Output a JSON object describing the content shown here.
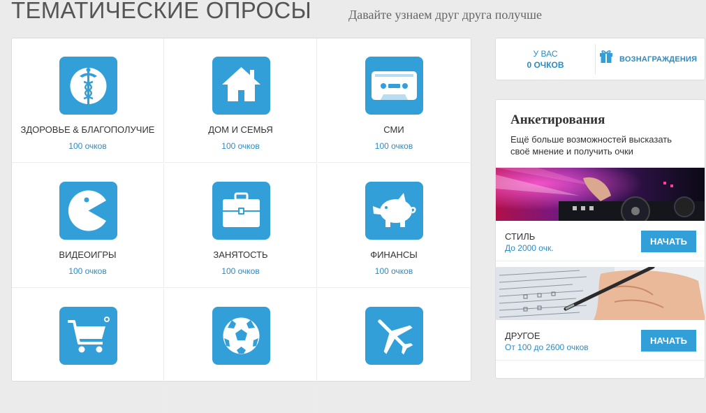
{
  "header": {
    "title": "ТЕМАТИЧЕСКИЕ ОПРОСЫ",
    "subtitle": "Давайте узнаем друг друга получше"
  },
  "categories": [
    {
      "label": "Здоровье & Благополучие",
      "points": "100 очков",
      "icon": "caduceus-icon"
    },
    {
      "label": "Дом и семья",
      "points": "100 очков",
      "icon": "house-icon"
    },
    {
      "label": "СМИ",
      "points": "100 очков",
      "icon": "cassette-icon"
    },
    {
      "label": "Видеоигры",
      "points": "100 очков",
      "icon": "pacman-icon"
    },
    {
      "label": "Занятость",
      "points": "100 очков",
      "icon": "briefcase-icon"
    },
    {
      "label": "Финансы",
      "points": "100 очков",
      "icon": "piggy-bank-icon"
    },
    {
      "label": "",
      "points": "",
      "icon": "shopping-cart-icon"
    },
    {
      "label": "",
      "points": "",
      "icon": "soccer-ball-icon"
    },
    {
      "label": "",
      "points": "",
      "icon": "airplane-icon"
    }
  ],
  "points_box": {
    "you_have": "У ВАС",
    "value": "0 ОЧКОВ",
    "rewards_label": "ВОЗНАГРАЖДЕНИЯ"
  },
  "surveys": {
    "title": "Анкетирования",
    "description": "Ещё больше возможностей высказать своё мнение и получить очки",
    "items": [
      {
        "name": "СТИЛЬ",
        "reward": "До 2000 очк.",
        "button": "НАЧАТЬ",
        "image": "dj-mixer-image"
      },
      {
        "name": "ДРУГОЕ",
        "reward": "От 100 до 2600 очков",
        "button": "НАЧАТЬ",
        "image": "pen-questionnaire-image"
      }
    ]
  },
  "colors": {
    "accent": "#329fd9",
    "link": "#2c8bc6",
    "background": "#ebebeb"
  }
}
